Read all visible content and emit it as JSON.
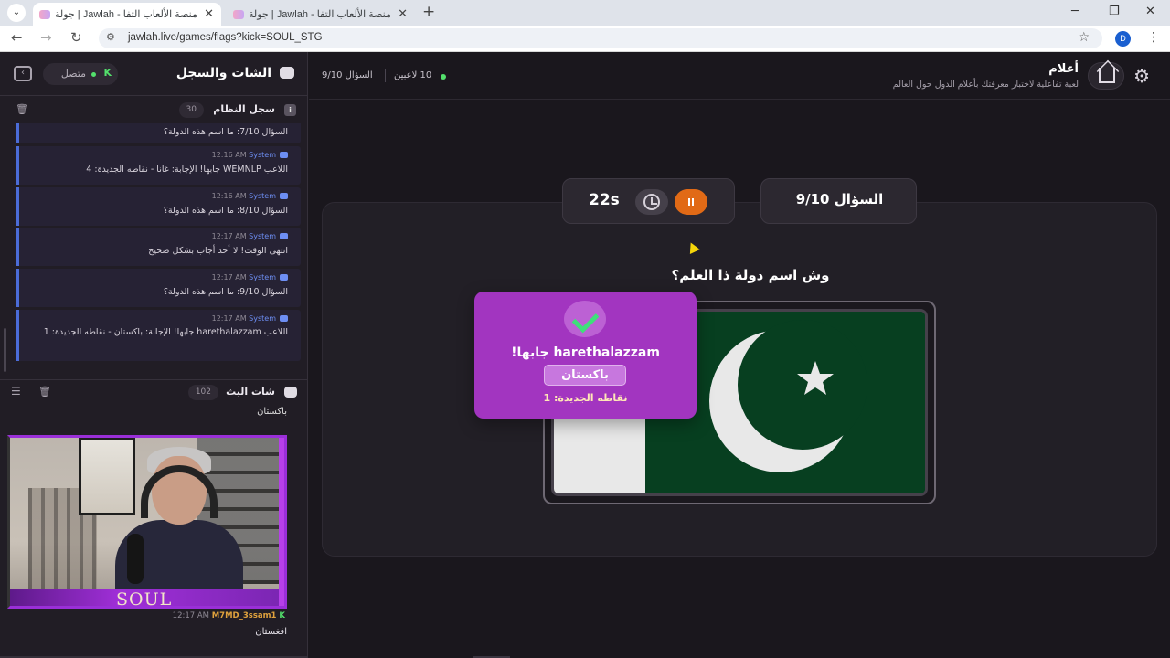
{
  "browser": {
    "tabs": [
      {
        "title": "جولة | Jawlah - منصة الألعاب التفا",
        "active": true
      },
      {
        "title": "جولة | Jawlah - منصة الألعاب التفا",
        "active": false
      }
    ],
    "new_tab": "+",
    "url": "jawlah.live/games/flags?kick=SOUL_STG",
    "profile_initial": "D"
  },
  "sidebar": {
    "title": "الشات والسجل",
    "status": "متصل",
    "status_color": "#53e06c",
    "system_log": {
      "title": "سجل النظام",
      "count": "30",
      "entries": [
        {
          "text": "السؤال 7/10: ما اسم هذه الدولة؟",
          "time": "",
          "sender": ""
        },
        {
          "text": "اللاعب WEMNLP جابها! الإجابة: غانا - نقاطه الجديدة: 4",
          "time": "12:16 AM",
          "sender": "System"
        },
        {
          "text": "السؤال 8/10: ما اسم هذه الدولة؟",
          "time": "12:16 AM",
          "sender": "System"
        },
        {
          "text": "انتهى الوقت! لا أحد أجاب بشكل صحيح",
          "time": "12:17 AM",
          "sender": "System"
        },
        {
          "text": "السؤال 9/10: ما اسم هذه الدولة؟",
          "time": "12:17 AM",
          "sender": "System"
        },
        {
          "text": "اللاعب harethalazzam جابها! الإجابة: باكستان - نقاطه الجديدة: 1",
          "time": "12:17 AM",
          "sender": "System"
        }
      ]
    },
    "stream_chat": {
      "title": "شات البث",
      "count": "102",
      "prev_message": "باكستان",
      "stream_overlay_text": "SOUL",
      "last_message": {
        "user": "M7MD_3ssam1",
        "time": "12:17 AM",
        "text": "افغستان"
      }
    }
  },
  "header": {
    "game_title": "أعلام",
    "game_subtitle": "لعبة تفاعلية لاختبار معرفتك بأعلام الدول حول العالم",
    "players": "10 لاعبين",
    "question_progress": "السؤال 9/10"
  },
  "game": {
    "question_label": "السؤال 9/10",
    "timer": "22s",
    "question_text": "وش اسم دولة ذا العلم؟",
    "flag": {
      "country": "Pakistan",
      "green": "#073f20",
      "white": "#e8e8e8"
    },
    "result": {
      "winner_text": "harethalazzam جابها!",
      "answer": "باكستان",
      "points_text": "نقاطه الجديدة: 1"
    }
  }
}
